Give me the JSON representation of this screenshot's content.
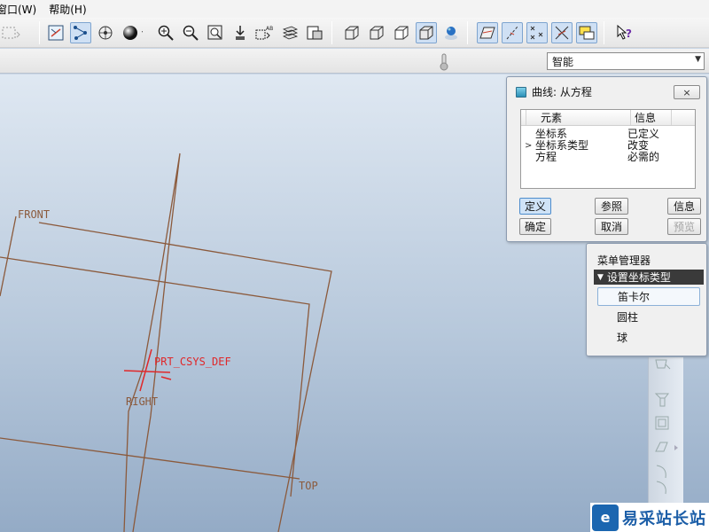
{
  "menubar": {
    "items": [
      {
        "label": "窗口(W)"
      },
      {
        "label": "帮助(H)"
      }
    ]
  },
  "toolbar": {
    "icons": [
      "select-box-icon",
      "datum-display-icon",
      "datum-points-icon",
      "spin-center-icon",
      "shading-sphere-icon",
      "zoom-in-icon",
      "zoom-out-icon",
      "refit-icon",
      "reorient-icon",
      "view-manager-icon",
      "layers-icon",
      "saved-views-icon",
      "wireframe-icon",
      "hidden-line-icon",
      "no-hidden-icon",
      "shaded-icon",
      "appearance-icon",
      "datum-planes-icon",
      "datum-axes-icon",
      "datum-points-toggle-icon",
      "csys-toggle-icon",
      "annotation-icon",
      "whats-this-icon"
    ]
  },
  "filterbar": {
    "filter_value": "智能"
  },
  "graphics": {
    "labels": {
      "front": "FRONT",
      "right": "RIGHT",
      "top": "TOP",
      "csys": "PRT_CSYS_DEF"
    },
    "colors": {
      "datum": "#8b5a3c",
      "csys": "#e0282a"
    }
  },
  "dialog": {
    "title": "曲线: 从方程",
    "close_label": "×",
    "table": {
      "headers": [
        "元素",
        "信息"
      ],
      "rows": [
        {
          "marker": "",
          "element": "坐标系",
          "info": "已定义"
        },
        {
          "marker": ">",
          "element": "坐标系类型",
          "info": "改变"
        },
        {
          "marker": "",
          "element": "方程",
          "info": "必需的"
        }
      ]
    },
    "buttons": {
      "define": "定义",
      "reference": "参照",
      "info": "信息",
      "ok": "确定",
      "cancel": "取消",
      "preview": "预览"
    }
  },
  "menu_manager": {
    "title": "菜单管理器",
    "header": "设置坐标类型",
    "items": [
      {
        "label": "笛卡尔"
      },
      {
        "label": "圆柱"
      },
      {
        "label": "球"
      }
    ]
  },
  "watermark": {
    "text": "易采站长站"
  }
}
